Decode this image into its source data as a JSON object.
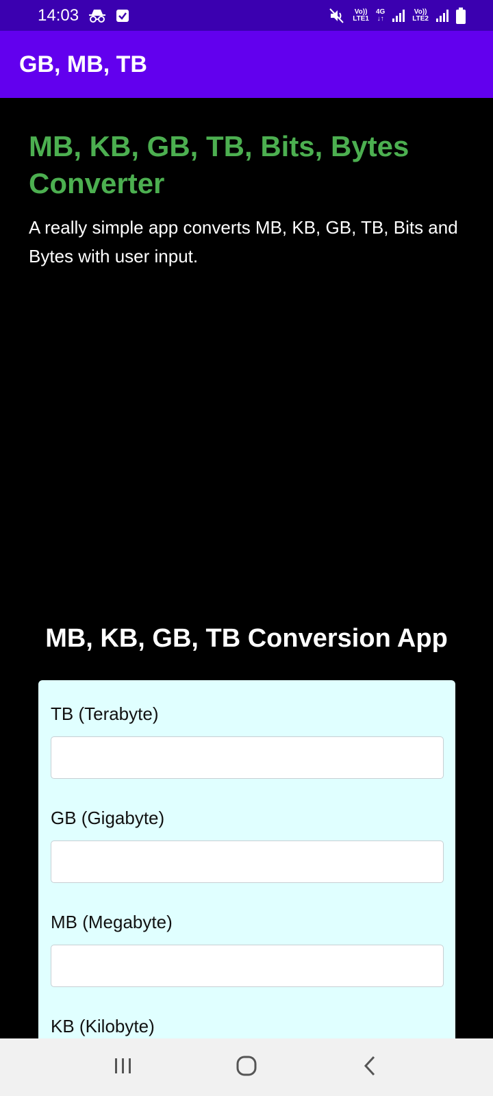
{
  "status_bar": {
    "time": "14:03",
    "left_icons": [
      "incognito-icon",
      "checkbox-icon"
    ],
    "right_icons": [
      "mute-icon",
      "volte-lte1-icon",
      "4g-icon",
      "signal-icon",
      "volte-lte2-icon",
      "signal-icon",
      "battery-icon"
    ],
    "volte_label": "Vo))",
    "lte1_label": "LTE1",
    "lte2_label": "LTE2",
    "net_label": "4G"
  },
  "app_bar": {
    "title": "GB, MB, TB"
  },
  "main": {
    "heading": "MB, KB, GB, TB, Bits, Bytes Converter",
    "description": "A really simple app converts MB, KB, GB, TB, Bits and Bytes with user input.",
    "section_title": "MB, KB, GB, TB Conversion App"
  },
  "converter": {
    "fields": [
      {
        "label": "TB (Terabyte)",
        "value": ""
      },
      {
        "label": "GB (Gigabyte)",
        "value": ""
      },
      {
        "label": "MB (Megabyte)",
        "value": ""
      },
      {
        "label": "KB (Kilobyte)",
        "value": ""
      }
    ]
  },
  "colors": {
    "status_bar": "#3b00b0",
    "app_bar": "#6200ee",
    "heading": "#4caf50",
    "card": "#e0ffff"
  },
  "nav_bar": {
    "buttons": [
      "recents-icon",
      "home-icon",
      "back-icon"
    ]
  }
}
